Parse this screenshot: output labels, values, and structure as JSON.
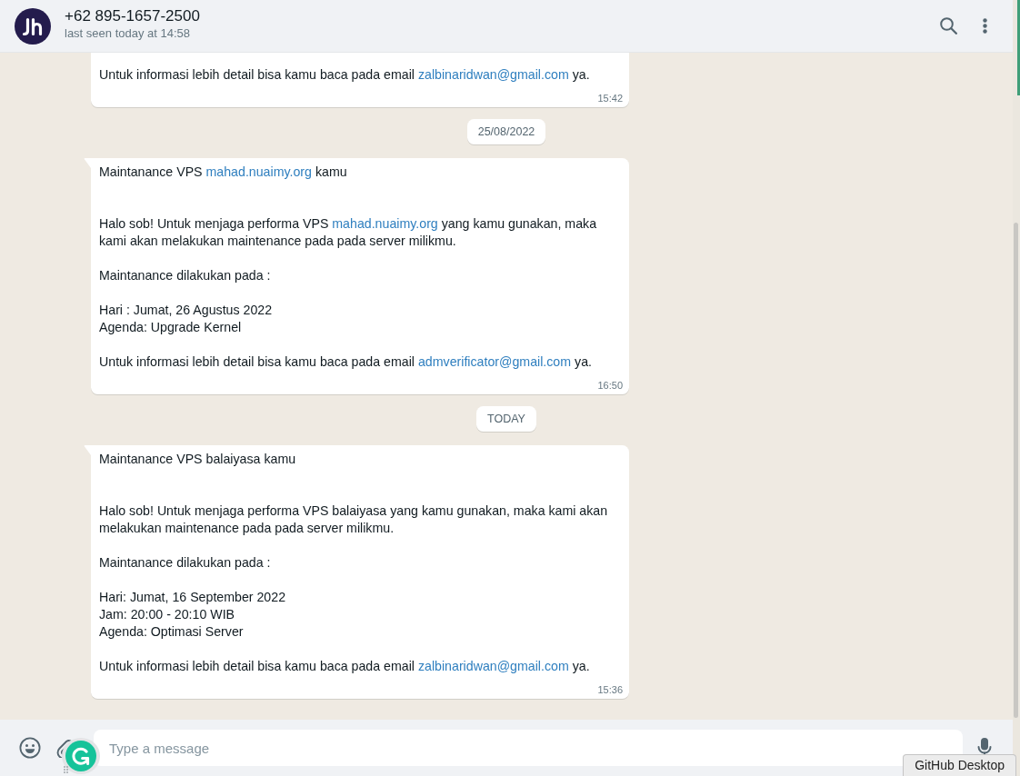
{
  "header": {
    "contact_name": "+62 895-1657-2500",
    "status": "last seen today at 14:58"
  },
  "chat": [
    {
      "kind": "message",
      "paragraphs": [
        {
          "lines": [
            [
              {
                "kind": "text",
                "text": "Untuk informasi lebih detail bisa kamu baca pada email "
              },
              {
                "kind": "link",
                "text": "zalbinaridwan@gmail.com"
              },
              {
                "kind": "text",
                "text": " ya."
              }
            ]
          ]
        }
      ],
      "time": "15:42"
    },
    {
      "kind": "date",
      "text": "25/08/2022"
    },
    {
      "kind": "message",
      "title": [
        {
          "kind": "text",
          "text": "Maintanance VPS "
        },
        {
          "kind": "link",
          "text": "mahad.nuaimy.org"
        },
        {
          "kind": "text",
          "text": " kamu"
        }
      ],
      "paragraphs": [
        {
          "lines": [
            [
              {
                "kind": "text",
                "text": "Halo sob! Untuk menjaga performa VPS "
              },
              {
                "kind": "link",
                "text": "mahad.nuaimy.org"
              },
              {
                "kind": "text",
                "text": " yang kamu gunakan, maka kami akan melakukan maintenance pada pada server milikmu."
              }
            ]
          ]
        },
        {
          "lines": [
            [
              {
                "kind": "text",
                "text": "Maintanance dilakukan pada :"
              }
            ]
          ]
        },
        {
          "lines": [
            [
              {
                "kind": "text",
                "text": "Hari : Jumat, 26 Agustus 2022"
              }
            ],
            [
              {
                "kind": "text",
                "text": "Agenda: Upgrade Kernel"
              }
            ]
          ]
        },
        {
          "lines": [
            [
              {
                "kind": "text",
                "text": "Untuk informasi lebih detail bisa kamu baca pada email "
              },
              {
                "kind": "link",
                "text": "admverificator@gmail.com"
              },
              {
                "kind": "text",
                "text": " ya."
              }
            ]
          ]
        }
      ],
      "time": "16:50"
    },
    {
      "kind": "date",
      "text": "TODAY"
    },
    {
      "kind": "message",
      "title": [
        {
          "kind": "text",
          "text": "Maintanance VPS balaiyasa kamu"
        }
      ],
      "paragraphs": [
        {
          "lines": [
            [
              {
                "kind": "text",
                "text": "Halo sob! Untuk menjaga performa VPS balaiyasa yang kamu gunakan, maka kami akan melakukan maintenance pada pada server milikmu."
              }
            ]
          ]
        },
        {
          "lines": [
            [
              {
                "kind": "text",
                "text": "Maintanance dilakukan pada :"
              }
            ]
          ]
        },
        {
          "lines": [
            [
              {
                "kind": "text",
                "text": "Hari: Jumat, 16 September 2022"
              }
            ],
            [
              {
                "kind": "text",
                "text": "Jam: 20:00 - 20:10 WIB"
              }
            ],
            [
              {
                "kind": "text",
                "text": "Agenda: Optimasi Server"
              }
            ]
          ]
        },
        {
          "lines": [
            [
              {
                "kind": "text",
                "text": "Untuk informasi lebih detail bisa kamu baca pada email "
              },
              {
                "kind": "link",
                "text": "zalbinaridwan@gmail.com"
              },
              {
                "kind": "text",
                "text": " ya."
              }
            ]
          ]
        }
      ],
      "time": "15:36"
    }
  ],
  "composer": {
    "placeholder": "Type a message"
  },
  "tooltip": {
    "text": "GitHub Desktop"
  }
}
